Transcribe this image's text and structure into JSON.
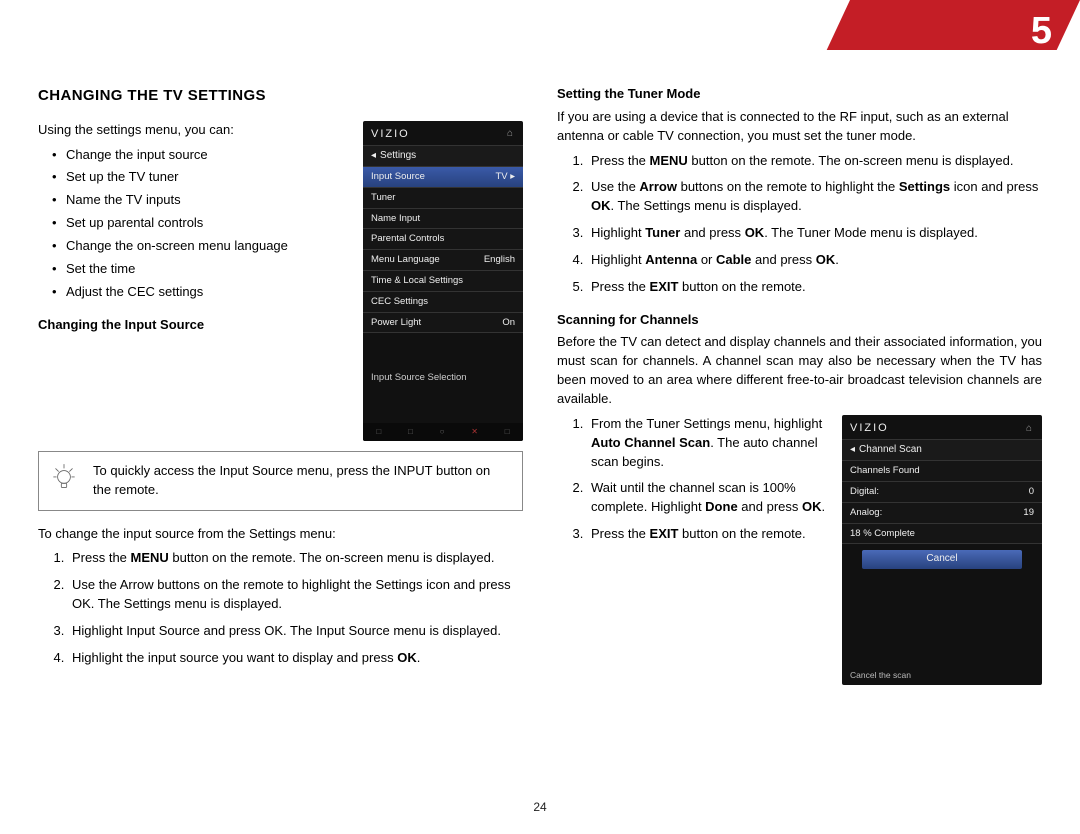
{
  "chapter_number": "5",
  "page_number": "24",
  "left": {
    "section_heading": "CHANGING THE TV SETTINGS",
    "intro": "Using the settings menu, you can:",
    "bullets": [
      "Change the input source",
      "Set up the TV tuner",
      "Name the TV inputs",
      "Set up parental controls",
      "Change the on-screen menu language",
      "Set the time",
      "Adjust the CEC settings"
    ],
    "sub1": "Changing the Input Source",
    "tip": "To quickly access the Input Source menu, press the INPUT button on the remote.",
    "lead1": "To change the input source from the Settings menu:",
    "steps1": [
      "Press the <b>MENU</b> button on the remote. The on-screen menu is displayed.",
      "Use the Arrow buttons on the remote to highlight the Settings icon and press OK. The Settings menu is displayed.",
      "Highlight Input Source and press OK. The Input Source menu is displayed.",
      "Highlight the input source you want to display and press <b>OK</b>."
    ],
    "screenshot": {
      "brand": "VIZIO",
      "title": "Settings",
      "rows": [
        {
          "label": "Input Source",
          "value": "TV ▸",
          "hl": true
        },
        {
          "label": "Tuner",
          "value": ""
        },
        {
          "label": "Name Input",
          "value": ""
        },
        {
          "label": "Parental Controls",
          "value": ""
        },
        {
          "label": "Menu Language",
          "value": "English"
        },
        {
          "label": "Time & Local Settings",
          "value": ""
        },
        {
          "label": "CEC Settings",
          "value": ""
        },
        {
          "label": "Power Light",
          "value": "On"
        }
      ],
      "info": "Input Source Selection"
    }
  },
  "right": {
    "sub1": "Setting the Tuner Mode",
    "para1": "If you are using a device that is connected to the RF input, such as an external antenna or cable TV connection, you must set the tuner mode.",
    "steps1": [
      "Press the <b>MENU</b> button on the remote. The on-screen menu is displayed.",
      "Use the <b>Arrow</b> buttons on the remote to highlight the <b>Settings</b> icon and press <b>OK</b>. The Settings menu is displayed.",
      "Highlight <b>Tuner</b> and press <b>OK</b>. The Tuner Mode menu is displayed.",
      "Highlight <b>Antenna</b> or <b>Cable</b> and press <b>OK</b>.",
      "Press the <b>EXIT</b> button on the remote."
    ],
    "sub2": "Scanning for Channels",
    "para2": "Before the TV can detect and display channels and their associated information, you must scan for channels. A channel scan may also be necessary when the TV has been moved to an area where different free-to-air broadcast television channels are available.",
    "steps2": [
      "From the Tuner Settings menu, highlight <b>Auto Channel Scan</b>. The auto channel scan begins.",
      "Wait until the channel scan is 100% complete. Highlight <b>Done</b> and press <b>OK</b>.",
      "Press the <b>EXIT</b> button on the remote."
    ],
    "screenshot": {
      "brand": "VIZIO",
      "title": "Channel Scan",
      "rows": [
        {
          "label": "Channels Found",
          "value": ""
        },
        {
          "label": "Digital:",
          "value": "0"
        },
        {
          "label": "Analog:",
          "value": "19"
        },
        {
          "label": "18 % Complete",
          "value": ""
        }
      ],
      "button": "Cancel",
      "footer": "Cancel the scan"
    }
  }
}
